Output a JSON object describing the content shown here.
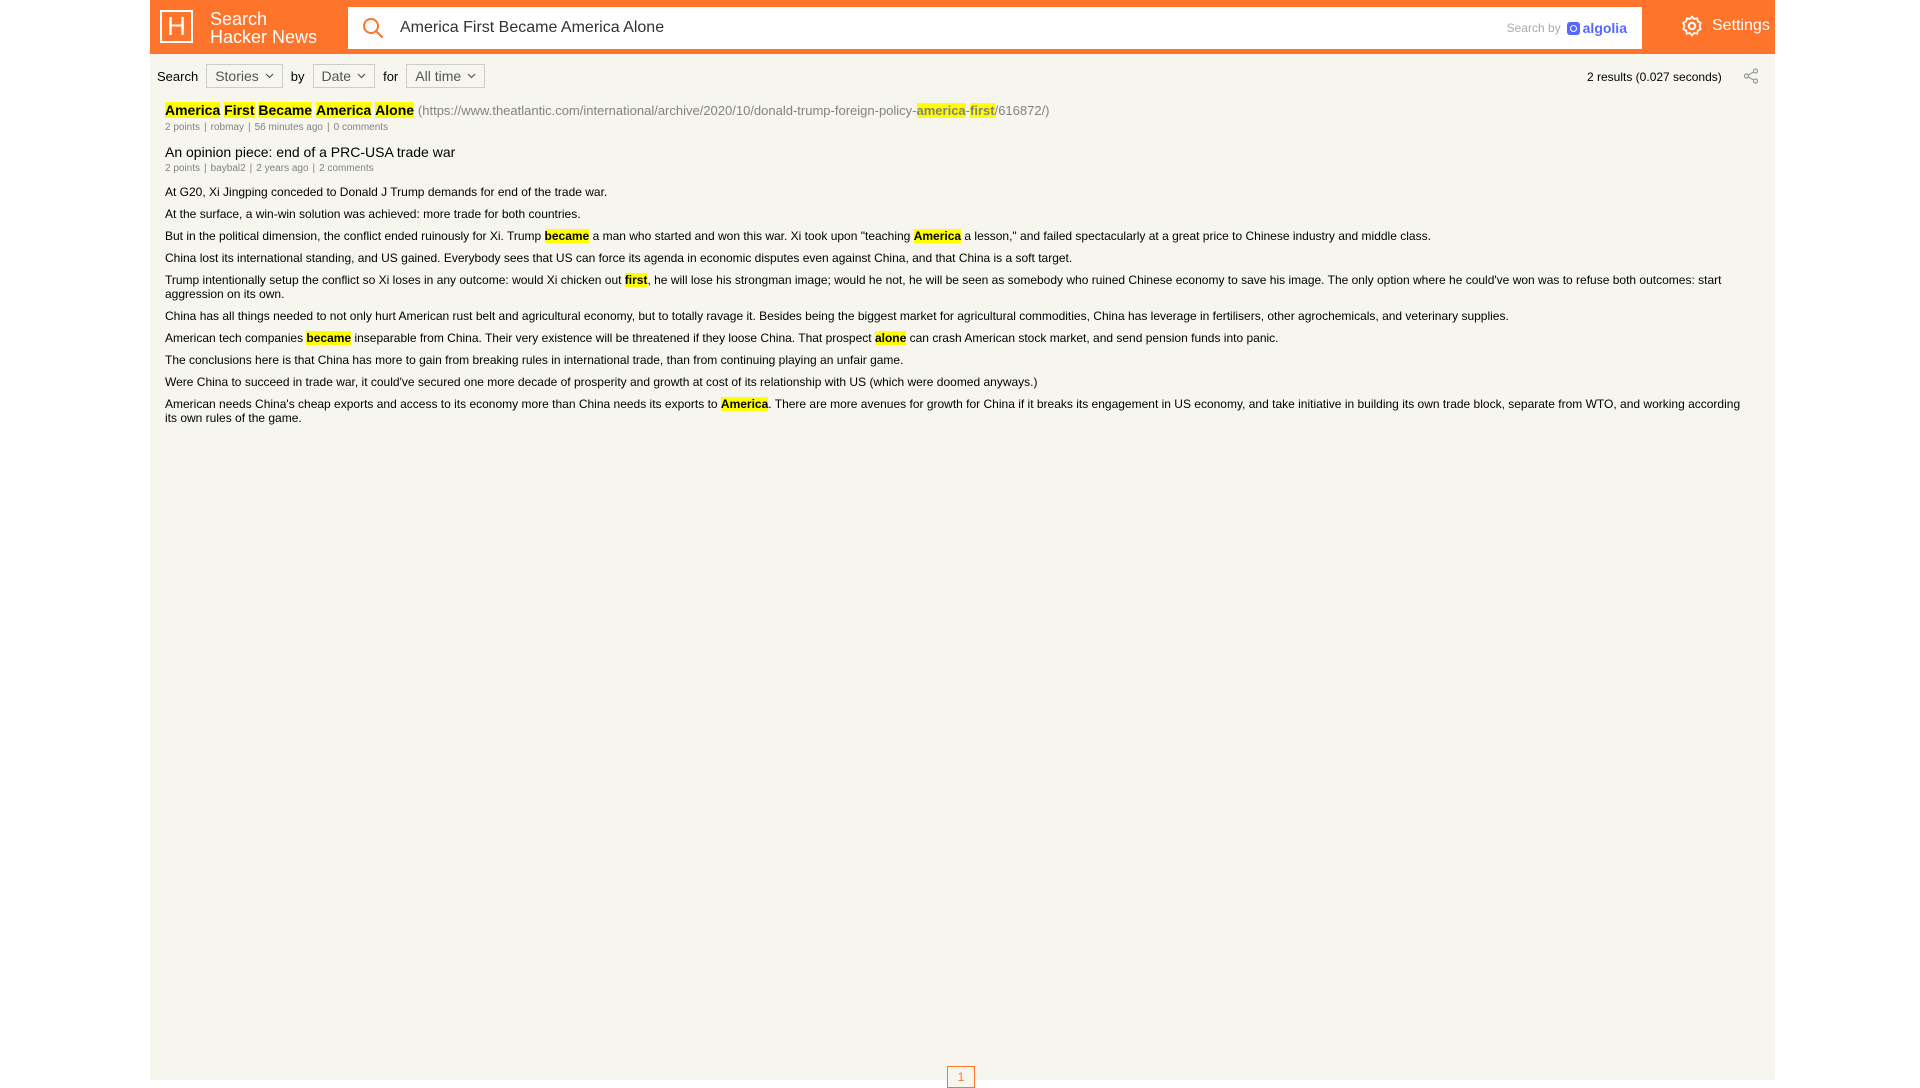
{
  "header": {
    "logo_letter": "H",
    "brand_line1": "Search",
    "brand_line2": "Hacker News",
    "search_value": "America First Became America Alone",
    "search_by": "Search by",
    "algolia_label": "algolia",
    "settings_label": "Settings",
    "accent_color": "#ff742b"
  },
  "filters": {
    "search_label": "Search",
    "type_value": "Stories",
    "by_label": "by",
    "sort_value": "Date",
    "for_label": "for",
    "range_value": "All time"
  },
  "results_info": "2 results (0.027 seconds)",
  "stories": [
    {
      "title_parts": [
        "America",
        "First",
        "Became",
        "America",
        "Alone"
      ],
      "url_prefix": "(https://www.theatlantic.com/international/archive/2020/10/donald-trump-foreign-policy-",
      "url_hl1": "america",
      "url_dash": "-",
      "url_hl2": "first",
      "url_suffix": "/616872/)",
      "points": "2 points",
      "author": "robmay",
      "time": "56 minutes ago",
      "comments": "0 comments"
    },
    {
      "title": "An opinion piece: end of a PRC-USA trade war",
      "points": "2 points",
      "author": "baybal2",
      "time": "2 years ago",
      "comments": "2 comments",
      "text": {
        "p1": "At G20, Xi Jingping conceded to Donald J Trump demands for end of the trade war.",
        "p2": "At the surface, a win-win solution was achieved: more trade for both countries.",
        "p3_a": "But in the political dimension, the conflict ended ruinously for Xi. Trump ",
        "p3_hl1": "became",
        "p3_b": " a man who started and won this war. Xi took upon \"teaching ",
        "p3_hl2": "America",
        "p3_c": " a lesson,\" and failed spectacularly at a great price to Chinese industry and middle class.",
        "p4": "China lost its international standing, and US gained. Everybody sees that US can force its agenda in economic disputes even against China, and that China is a soft target.",
        "p5_a": "Trump intentionally setup the conflict so Xi loses in any outcome: would Xi chicken out ",
        "p5_hl": "first",
        "p5_b": ", he will lose his strongman image; would he not, he will be seen as somebody who ruined Chinese economy to save his image. The only option where he could've won was to refuse both outcomes: start aggression on its own.",
        "p6": "China has all things needed to not only hurt American rust belt and agricultural economy, but to totally ravage it. Besides being the biggest market for agricultural commodities, China has leverage in fertilisers, other agrochemicals, and veterinary supplies.",
        "p7_a": "American tech companies ",
        "p7_hl1": "became",
        "p7_b": " inseparable from China. Their very existence will be threatened if they loose China. That prospect ",
        "p7_hl2": "alone",
        "p7_c": " can crash American stock market, and send pension funds into panic.",
        "p8": "The conclusions here is that China has more to gain from breaking rules in international trade, than from continuing playing an unfair game.",
        "p9": "Were China to succeed in trade war, it could've secured one more decade of prosperity and growth at cost of its relationship with US (which were doomed anyways.)",
        "p10_a": "American needs China's cheap exports and access to its economy more than China needs its exports to ",
        "p10_hl": "America",
        "p10_b": ". There are more avenues for growth for China if it breaks its engagement in US economy, and take initiative in building its own trade block, separate from WTO, and working according its own rules of the game."
      }
    }
  ],
  "pagination": {
    "current": "1"
  }
}
